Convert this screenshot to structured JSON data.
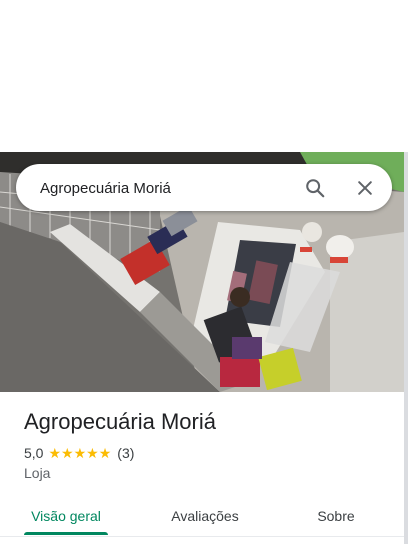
{
  "search": {
    "value": "Agropecuária Moriá",
    "search_icon": "search-icon",
    "close_icon": "close-icon"
  },
  "place": {
    "title": "Agropecuária Moriá",
    "rating": "5,0",
    "stars": 5,
    "review_count": "(3)",
    "category": "Loja"
  },
  "tabs": [
    {
      "label": "Visão geral",
      "active": true
    },
    {
      "label": "Avaliações",
      "active": false
    },
    {
      "label": "Sobre",
      "active": false
    }
  ],
  "colors": {
    "accent": "#01875f",
    "star": "#fbbc04"
  }
}
